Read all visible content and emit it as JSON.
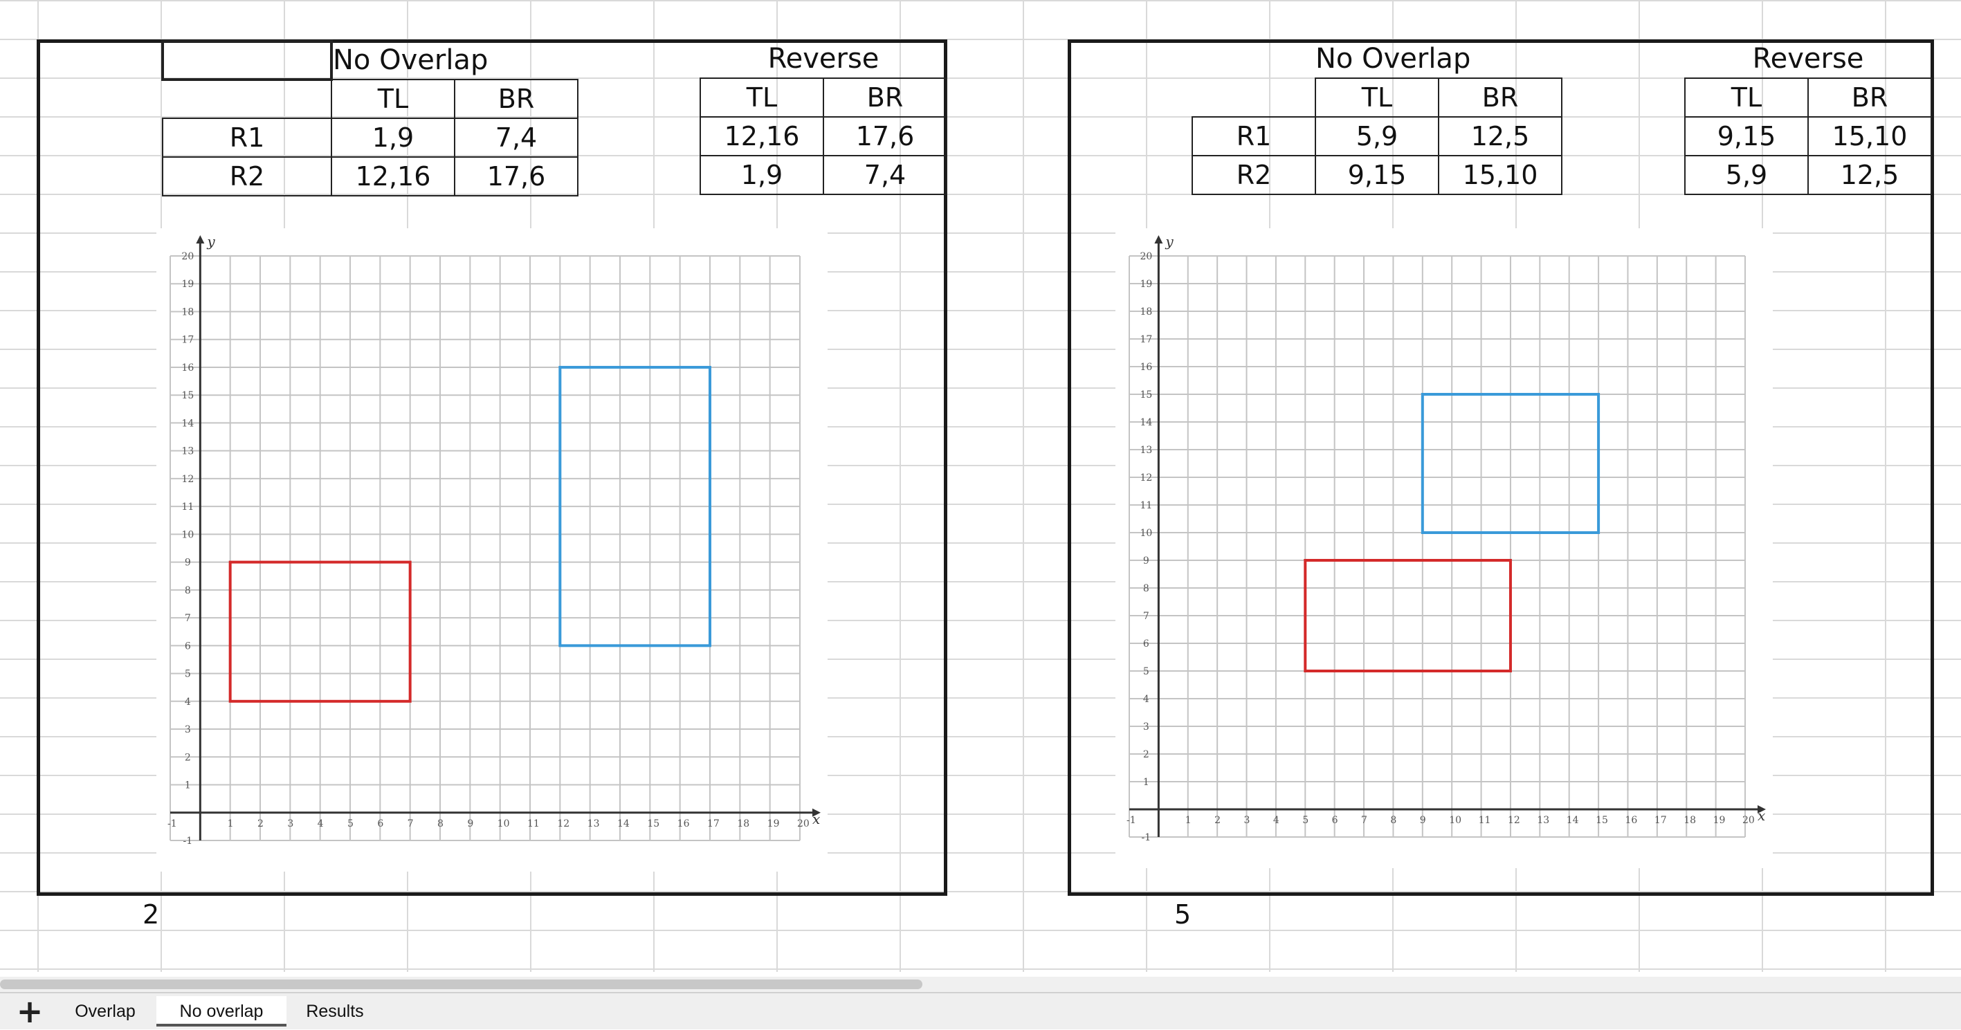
{
  "left": {
    "no_overlap_title": "No Overlap",
    "reverse_title": "Reverse",
    "tl": "TL",
    "br": "BR",
    "rows": [
      {
        "label": "R1",
        "tl": "1,9",
        "br": "7,4",
        "rev_tl": "12,16",
        "rev_br": "17,6"
      },
      {
        "label": "R2",
        "tl": "12,16",
        "br": "17,6",
        "rev_tl": "1,9",
        "rev_br": "7,4"
      }
    ],
    "footer_number": "2"
  },
  "right": {
    "no_overlap_title": "No Overlap",
    "reverse_title": "Reverse",
    "tl": "TL",
    "br": "BR",
    "rows": [
      {
        "label": "R1",
        "tl": "5,9",
        "br": "12,5",
        "rev_tl": "9,15",
        "rev_br": "15,10"
      },
      {
        "label": "R2",
        "tl": "9,15",
        "br": "15,10",
        "rev_tl": "5,9",
        "rev_br": "12,5"
      }
    ],
    "footer_number": "5"
  },
  "graph": {
    "x_axis_label": "x",
    "y_axis_label": "y",
    "x_range": [
      -1,
      20
    ],
    "y_range": [
      -1,
      20
    ]
  },
  "plots": [
    {
      "rects": [
        {
          "tl": [
            1,
            9
          ],
          "br": [
            7,
            4
          ],
          "color": "#d42a2a"
        },
        {
          "tl": [
            12,
            16
          ],
          "br": [
            17,
            6
          ],
          "color": "#3a9ad9"
        }
      ]
    },
    {
      "rects": [
        {
          "tl": [
            5,
            9
          ],
          "br": [
            12,
            5
          ],
          "color": "#d42a2a"
        },
        {
          "tl": [
            9,
            15
          ],
          "br": [
            15,
            10
          ],
          "color": "#3a9ad9"
        }
      ]
    }
  ],
  "tabs": {
    "add_label": "+",
    "items": [
      "Overlap",
      "No overlap",
      "Results"
    ],
    "active": "No overlap"
  }
}
